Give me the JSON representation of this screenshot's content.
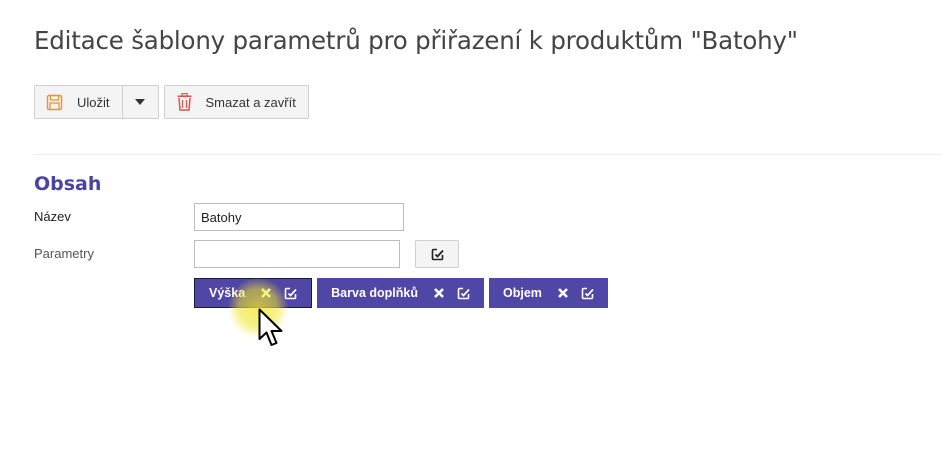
{
  "page": {
    "title": "Editace šablony parametrů pro přiřazení k produktům \"Batohy\""
  },
  "toolbar": {
    "save_label": "Uložit",
    "delete_label": "Smazat a zavřít"
  },
  "section": {
    "title": "Obsah"
  },
  "form": {
    "name_label": "Název",
    "name_value": "Batohy",
    "params_label": "Parametry",
    "params_value": ""
  },
  "parameters": [
    {
      "label": "Výška",
      "active": true
    },
    {
      "label": "Barva doplňků",
      "active": false
    },
    {
      "label": "Objem",
      "active": false
    }
  ],
  "colors": {
    "accent": "#5046a6",
    "save_icon": "#e8963a",
    "delete_icon": "#d9534f",
    "cursor_highlight": "#f0e628"
  },
  "icons": {
    "save": "floppy-disk-icon",
    "caret": "caret-down-icon",
    "delete": "trash-icon",
    "edit": "edit-icon",
    "remove": "close-icon",
    "cursor": "mouse-pointer-icon"
  }
}
